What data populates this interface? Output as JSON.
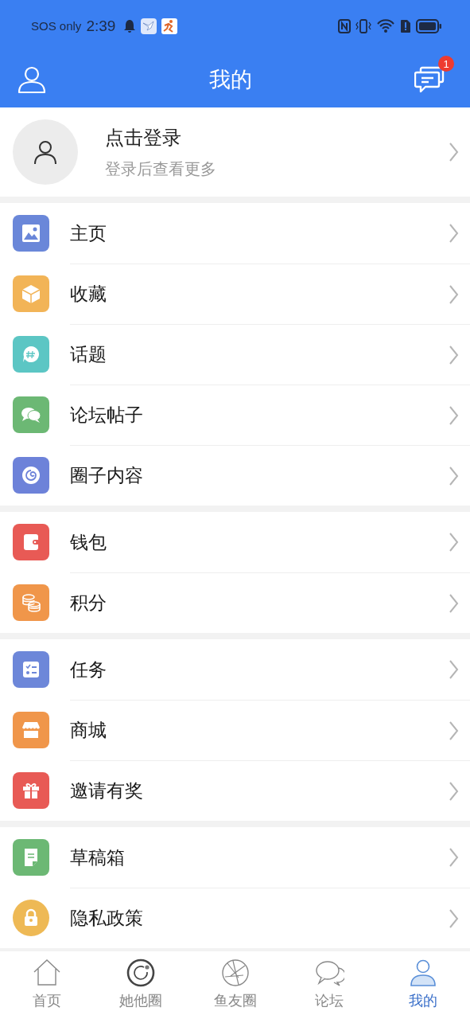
{
  "status_bar": {
    "carrier": "SOS only",
    "time": "2:39"
  },
  "header": {
    "title": "我的",
    "badge": "1"
  },
  "login": {
    "title": "点击登录",
    "subtitle": "登录后查看更多"
  },
  "groups": [
    {
      "items": [
        {
          "label": "主页",
          "kind": "image",
          "color": "#6a87d9"
        },
        {
          "label": "收藏",
          "kind": "box",
          "color": "#f2b457"
        },
        {
          "label": "话题",
          "kind": "hashtag",
          "color": "#5cc6c4"
        },
        {
          "label": "论坛帖子",
          "kind": "chat",
          "color": "#6cb874"
        },
        {
          "label": "圈子内容",
          "kind": "swirl",
          "color": "#6d82d9"
        }
      ]
    },
    {
      "items": [
        {
          "label": "钱包",
          "kind": "wallet",
          "color": "#e85a55"
        },
        {
          "label": "积分",
          "kind": "coins",
          "color": "#f0964a"
        }
      ]
    },
    {
      "items": [
        {
          "label": "任务",
          "kind": "checklist",
          "color": "#6d87d9"
        },
        {
          "label": "商城",
          "kind": "shop",
          "color": "#f0964a"
        },
        {
          "label": "邀请有奖",
          "kind": "gift",
          "color": "#e85a55"
        }
      ]
    },
    {
      "items": [
        {
          "label": "草稿箱",
          "kind": "document",
          "color": "#6cb874"
        },
        {
          "label": "隐私政策",
          "kind": "lock",
          "color": "#eeb955"
        }
      ]
    }
  ],
  "tabs": [
    {
      "label": "首页",
      "kind": "home",
      "selected": false
    },
    {
      "label": "她他圈",
      "kind": "ring",
      "selected": false
    },
    {
      "label": "鱼友圈",
      "kind": "aperture",
      "selected": false
    },
    {
      "label": "论坛",
      "kind": "chat",
      "selected": false
    },
    {
      "label": "我的",
      "kind": "person",
      "selected": true
    }
  ]
}
